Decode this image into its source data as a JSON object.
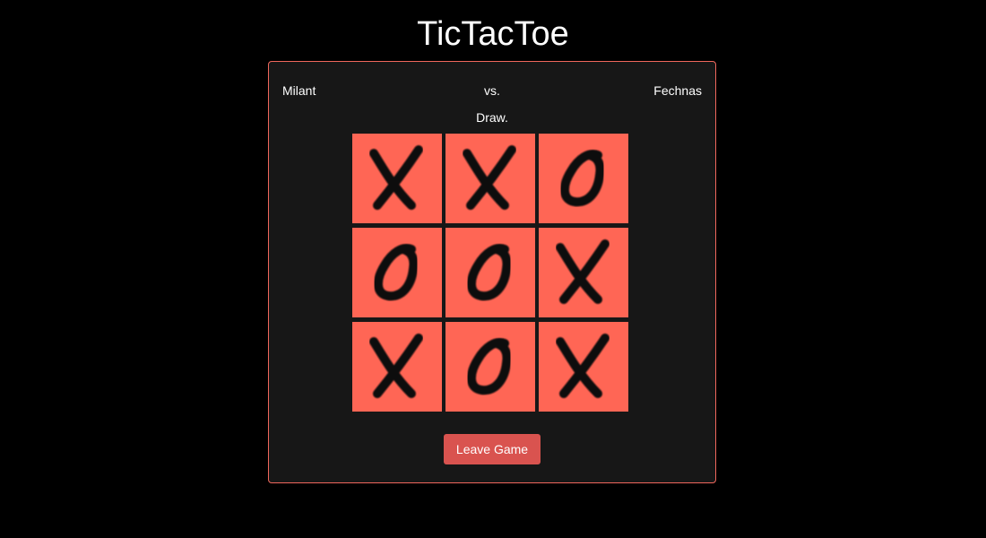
{
  "title": "TicTacToe",
  "players": {
    "left": "Milant",
    "versus": "vs.",
    "right": "Fechnas"
  },
  "status": "Draw.",
  "board": [
    [
      "X",
      "X",
      "O"
    ],
    [
      "O",
      "O",
      "X"
    ],
    [
      "X",
      "O",
      "X"
    ]
  ],
  "leave_button_label": "Leave Game",
  "colors": {
    "background": "#000000",
    "panel": "#171717",
    "panel_border": "#f0675c",
    "cell": "#ff6655",
    "mark": "#0d0d0d",
    "button": "#d9534f"
  },
  "icons": {
    "X": "x-mark-icon",
    "O": "o-mark-icon"
  }
}
